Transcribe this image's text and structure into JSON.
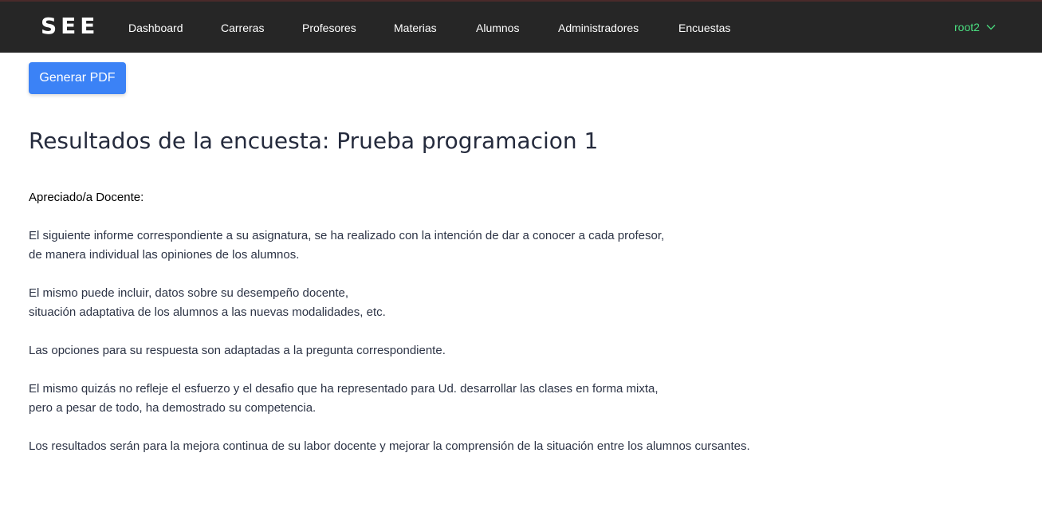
{
  "navbar": {
    "brand": "SEE",
    "items": [
      {
        "label": "Dashboard"
      },
      {
        "label": "Carreras"
      },
      {
        "label": "Profesores"
      },
      {
        "label": "Materias"
      },
      {
        "label": "Alumnos"
      },
      {
        "label": "Administradores"
      },
      {
        "label": "Encuestas"
      }
    ],
    "user": {
      "name": "root2",
      "icon": "chevron-down-icon",
      "color": "#4ade80"
    },
    "background": "#262626"
  },
  "actions": {
    "generate_pdf": "Generar PDF",
    "accent": "#3b82f6"
  },
  "main": {
    "title": "Resultados de la encuesta: Prueba programacion 1",
    "greeting": "Apreciado/a Docente:",
    "paragraphs": [
      {
        "line1": "El siguiente informe correspondiente a su asignatura, se ha realizado con la intención de dar a conocer a cada profesor,",
        "line2": "de manera individual las opiniones de los alumnos."
      },
      {
        "line1": "El mismo puede incluir, datos sobre su desempeño docente,",
        "line2": "situación adaptativa de los alumnos a las nuevas modalidades, etc."
      },
      {
        "line1": "Las opciones para su respuesta son adaptadas a la pregunta correspondiente."
      },
      {
        "line1": "El mismo quizás no refleje el esfuerzo y el desafio que ha representado para Ud. desarrollar las clases en forma mixta,",
        "line2": "pero a pesar de todo, ha demostrado su competencia."
      },
      {
        "line1": "Los resultados serán para la mejora continua de su labor docente y mejorar la comprensión de la situación entre los alumnos cursantes."
      }
    ]
  }
}
